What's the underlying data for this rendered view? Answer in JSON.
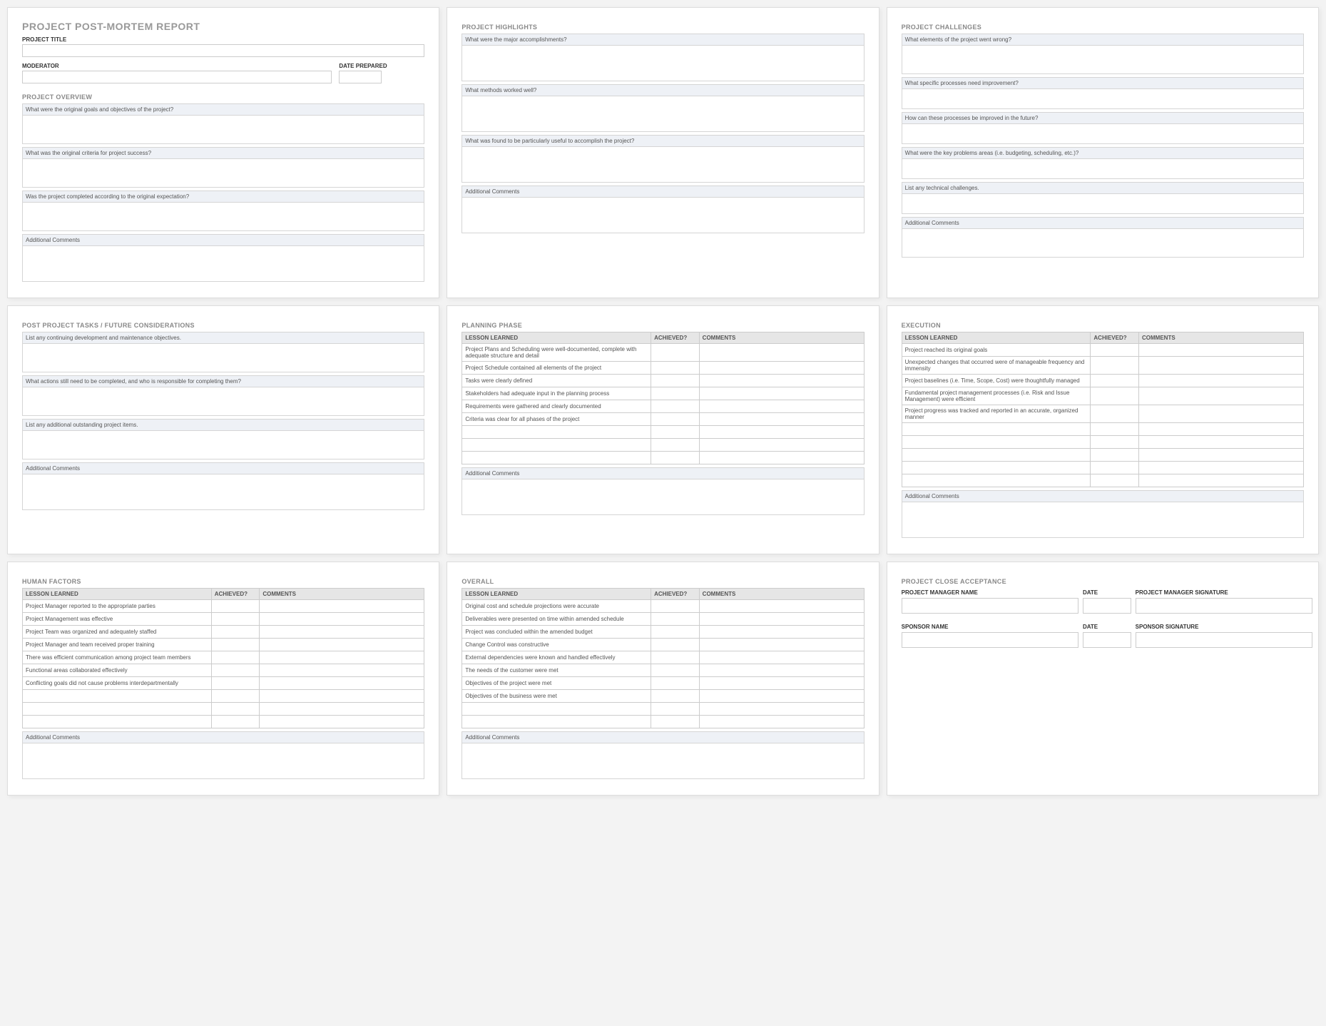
{
  "pane1": {
    "reportTitle": "PROJECT POST-MORTEM REPORT",
    "projectTitleLabel": "PROJECT TITLE",
    "moderatorLabel": "MODERATOR",
    "datePreparedLabel": "DATE PREPARED",
    "overviewTitle": "PROJECT OVERVIEW",
    "q1": "What were the original goals and objectives of the project?",
    "q2": "What was the original criteria for project success?",
    "q3": "Was the project completed according to the original expectation?",
    "additional": "Additional Comments"
  },
  "pane2": {
    "title": "PROJECT HIGHLIGHTS",
    "q1": "What were the major accomplishments?",
    "q2": "What methods worked well?",
    "q3": "What was found to be particularly useful to accomplish the project?",
    "additional": "Additional Comments"
  },
  "pane3": {
    "title": "PROJECT CHALLENGES",
    "q1": "What elements of the project went wrong?",
    "q2": "What specific processes need improvement?",
    "q3": "How can these processes be improved in the future?",
    "q4": "What were the key problems areas (i.e. budgeting, scheduling, etc.)?",
    "q5": "List any technical challenges.",
    "additional": "Additional Comments"
  },
  "pane4": {
    "title": "POST PROJECT TASKS / FUTURE CONSIDERATIONS",
    "q1": "List any continuing development and maintenance objectives.",
    "q2": "What actions still need to be completed, and who is responsible for completing them?",
    "q3": "List any additional outstanding project items.",
    "additional": "Additional Comments"
  },
  "pane5": {
    "title": "PLANNING PHASE",
    "headers": {
      "lesson": "LESSON LEARNED",
      "achieved": "ACHIEVED?",
      "comments": "COMMENTS"
    },
    "rows": [
      "Project Plans and Scheduling were well-documented, complete with adequate structure and detail",
      "Project Schedule contained all elements of the project",
      "Tasks were clearly defined",
      "Stakeholders had adequate input in the planning process",
      "Requirements were gathered and clearly documented",
      "Criteria was clear for all phases of the project",
      "",
      "",
      ""
    ],
    "additional": "Additional Comments"
  },
  "pane6": {
    "title": "EXECUTION",
    "headers": {
      "lesson": "LESSON LEARNED",
      "achieved": "ACHIEVED?",
      "comments": "COMMENTS"
    },
    "rows": [
      "Project reached its original goals",
      "Unexpected changes that occurred were of manageable frequency and immensity",
      "Project baselines (i.e. Time, Scope, Cost) were thoughtfully managed",
      "Fundamental project management processes (i.e. Risk and Issue Management) were efficient",
      "Project progress was tracked and reported in an accurate, organized manner",
      "",
      "",
      "",
      "",
      ""
    ],
    "additional": "Additional Comments"
  },
  "pane7": {
    "title": "HUMAN FACTORS",
    "headers": {
      "lesson": "LESSON LEARNED",
      "achieved": "ACHIEVED?",
      "comments": "COMMENTS"
    },
    "rows": [
      "Project Manager reported to the appropriate parties",
      "Project Management was effective",
      "Project Team was organized and adequately staffed",
      "Project Manager and team received proper training",
      "There was efficient communication among project team members",
      "Functional areas collaborated effectively",
      "Conflicting goals did not cause problems interdepartmentally",
      "",
      "",
      ""
    ],
    "additional": "Additional Comments"
  },
  "pane8": {
    "title": "OVERALL",
    "headers": {
      "lesson": "LESSON LEARNED",
      "achieved": "ACHIEVED?",
      "comments": "COMMENTS"
    },
    "rows": [
      "Original cost and schedule projections were accurate",
      "Deliverables were presented on time within amended schedule",
      "Project was concluded within the amended budget",
      "Change Control was constructive",
      "External dependencies were known and handled effectively",
      "The needs of the customer were met",
      "Objectives of the project were met",
      "Objectives of the business were met",
      "",
      ""
    ],
    "additional": "Additional Comments"
  },
  "pane9": {
    "title": "PROJECT CLOSE ACCEPTANCE",
    "row1": {
      "name": "PROJECT MANAGER NAME",
      "date": "DATE",
      "sig": "PROJECT MANAGER SIGNATURE"
    },
    "row2": {
      "name": "SPONSOR NAME",
      "date": "DATE",
      "sig": "SPONSOR SIGNATURE"
    }
  }
}
